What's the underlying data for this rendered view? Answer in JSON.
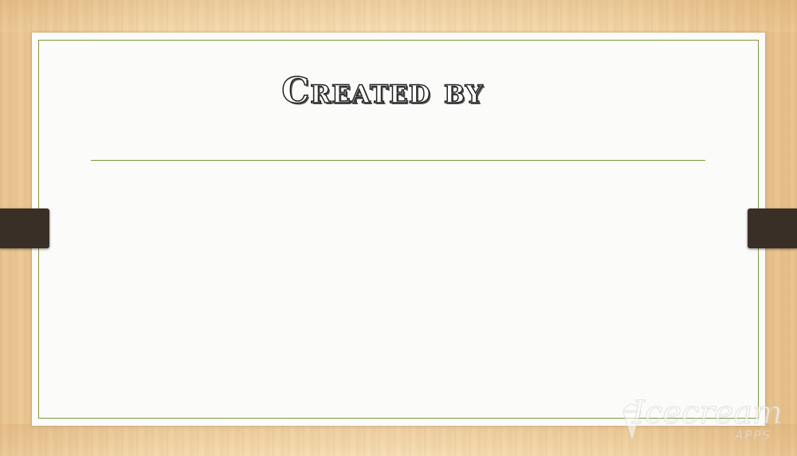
{
  "slide": {
    "title": "Created by"
  },
  "watermark": {
    "brand": "Icecream",
    "sub": "APPS",
    "icon": "ice-cream-cone-icon"
  },
  "colors": {
    "border_accent": "#7f9a3a",
    "paper": "#fbfbfa",
    "tab": "#3a2f27",
    "wood": "#f2d6a8"
  }
}
